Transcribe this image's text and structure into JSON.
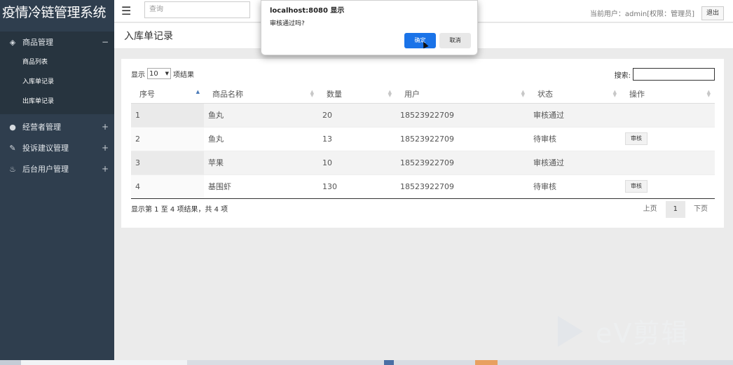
{
  "app": {
    "title": "疫情冷链管理系统"
  },
  "sidebar": {
    "groups": [
      {
        "label": "商品管理",
        "toggle": "−",
        "icon": "layers-icon"
      },
      {
        "label": "经营者管理",
        "toggle": "+",
        "icon": "user-icon"
      },
      {
        "label": "投诉建议管理",
        "toggle": "+",
        "icon": "edit-icon"
      },
      {
        "label": "后台用户管理",
        "toggle": "+",
        "icon": "fire-icon"
      }
    ],
    "subitems": [
      "商品列表",
      "入库单记录",
      "出库单记录"
    ]
  },
  "topbar": {
    "search_placeholder": "查询",
    "user_info": "当前用户：admin[权限：管理员]",
    "logout_label": "退出"
  },
  "page": {
    "title": "入库单记录"
  },
  "table": {
    "length_prefix": "显示",
    "length_value": "10",
    "length_suffix": "项结果",
    "search_label": "搜索:",
    "headers": [
      "序号",
      "商品名称",
      "数量",
      "用户",
      "状态",
      "操作"
    ],
    "rows": [
      {
        "id": "1",
        "name": "鱼丸",
        "qty": "20",
        "user": "18523922709",
        "status": "审核通过",
        "action": ""
      },
      {
        "id": "2",
        "name": "鱼丸",
        "qty": "13",
        "user": "18523922709",
        "status": "待审核",
        "action": "审核"
      },
      {
        "id": "3",
        "name": "苹果",
        "qty": "10",
        "user": "18523922709",
        "status": "审核通过",
        "action": ""
      },
      {
        "id": "4",
        "name": "基围虾",
        "qty": "130",
        "user": "18523922709",
        "status": "待审核",
        "action": "审核"
      }
    ],
    "info": "显示第 1 至 4 项结果，共 4 项",
    "pager": {
      "prev": "上页",
      "current": "1",
      "next": "下页"
    }
  },
  "dialog": {
    "title": "localhost:8080 显示",
    "message": "审核通过吗?",
    "ok_label": "确定",
    "cancel_label": "取消"
  },
  "watermark": {
    "text": "eV剪辑"
  },
  "colors": {
    "sidebar_bg": "#2f3e4e",
    "primary_button": "#1a73e8"
  }
}
